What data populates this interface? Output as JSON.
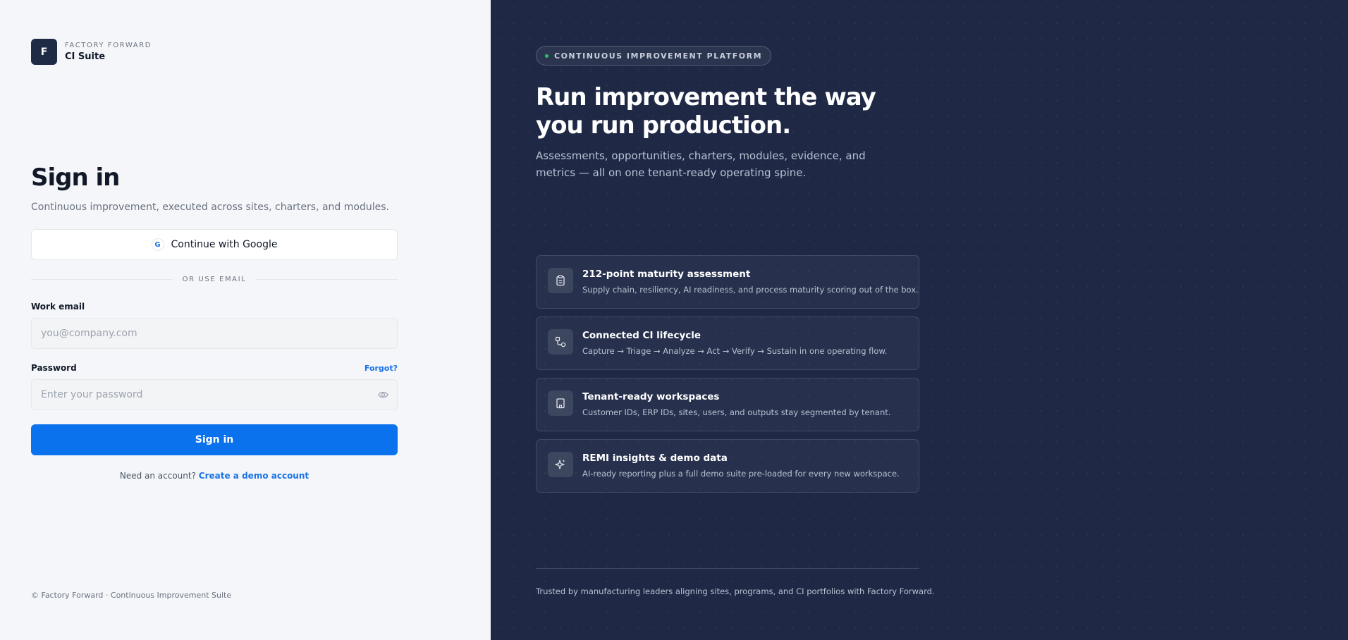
{
  "brand": {
    "logo_letter": "F",
    "supertitle": "FACTORY FORWARD",
    "name": "CI Suite"
  },
  "signin": {
    "title": "Sign in",
    "subtitle": "Continuous improvement, executed across sites, charters, and modules.",
    "google_label": "Continue with Google",
    "google_icon_letter": "G",
    "divider": "OR USE EMAIL",
    "email_label": "Work email",
    "email_placeholder": "you@company.com",
    "password_label": "Password",
    "forgot": "Forgot?",
    "password_placeholder": "Enter your password",
    "submit": "Sign in",
    "account_prompt": "Need an account?",
    "account_link": "Create a demo account"
  },
  "footer_left": "© Factory Forward · Continuous Improvement Suite",
  "right": {
    "pill": "CONTINUOUS IMPROVEMENT PLATFORM",
    "hero": "Run improvement the way you run production.",
    "hero_sub": "Assessments, opportunities, charters, modules, evidence, and metrics — all on one tenant-ready operating spine.",
    "features": [
      {
        "icon": "clipboard-icon",
        "title": "212-point maturity assessment",
        "desc": "Supply chain, resiliency, AI readiness, and process maturity scoring out of the box."
      },
      {
        "icon": "workflow-icon",
        "title": "Connected CI lifecycle",
        "desc": "Capture → Triage → Analyze → Act → Verify → Sustain in one operating flow."
      },
      {
        "icon": "building-icon",
        "title": "Tenant-ready workspaces",
        "desc": "Customer IDs, ERP IDs, sites, users, and outputs stay segmented by tenant."
      },
      {
        "icon": "sparkle-icon",
        "title": "REMI insights & demo data",
        "desc": "AI-ready reporting plus a full demo suite pre-loaded for every new workspace."
      }
    ],
    "trusted": "Trusted by manufacturing leaders aligning sites, programs, and CI portfolios with Factory Forward."
  },
  "colors": {
    "primary": "#0b72ee",
    "panel_dark": "#1f2946",
    "logo_bg": "#1f2a44",
    "status_dot": "#22c55e"
  }
}
